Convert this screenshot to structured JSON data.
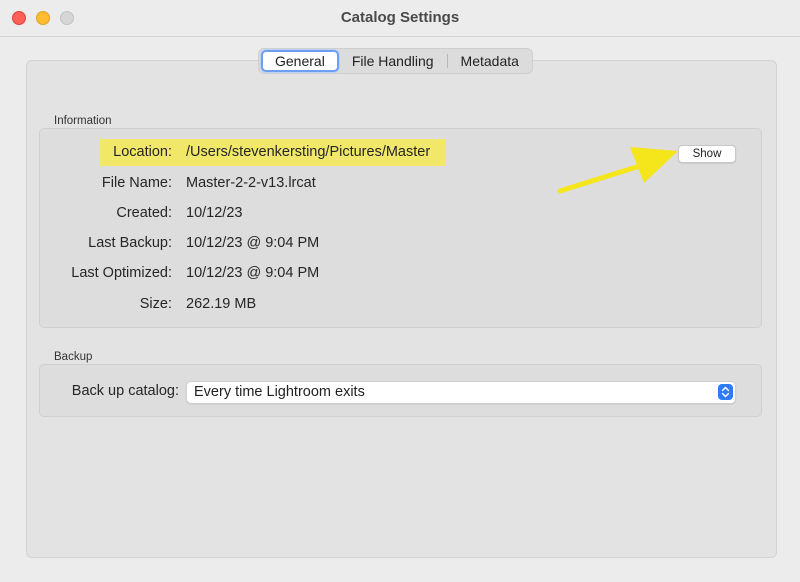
{
  "window": {
    "title": "Catalog Settings"
  },
  "tabs": [
    {
      "label": "General",
      "active": true
    },
    {
      "label": "File Handling",
      "active": false
    },
    {
      "label": "Metadata",
      "active": false
    }
  ],
  "information": {
    "section_label": "Information",
    "fields": [
      {
        "label": "Location:",
        "value": "/Users/stevenkersting/Pictures/Master"
      },
      {
        "label": "File Name:",
        "value": "Master-2-2-v13.lrcat"
      },
      {
        "label": "Created:",
        "value": "10/12/23"
      },
      {
        "label": "Last Backup:",
        "value": "10/12/23 @ 9:04 PM"
      },
      {
        "label": "Last Optimized:",
        "value": "10/12/23 @ 9:04 PM"
      },
      {
        "label": "Size:",
        "value": "262.19 MB"
      }
    ],
    "show_button": "Show"
  },
  "backup": {
    "section_label": "Backup",
    "label": "Back up catalog:",
    "selected": "Every time Lightroom exits"
  },
  "colors": {
    "highlight": "#f1e86a",
    "annotation_arrow": "#f5e61c",
    "tab_focus": "#6e9ef0",
    "stepper": "#2e7cf6"
  }
}
